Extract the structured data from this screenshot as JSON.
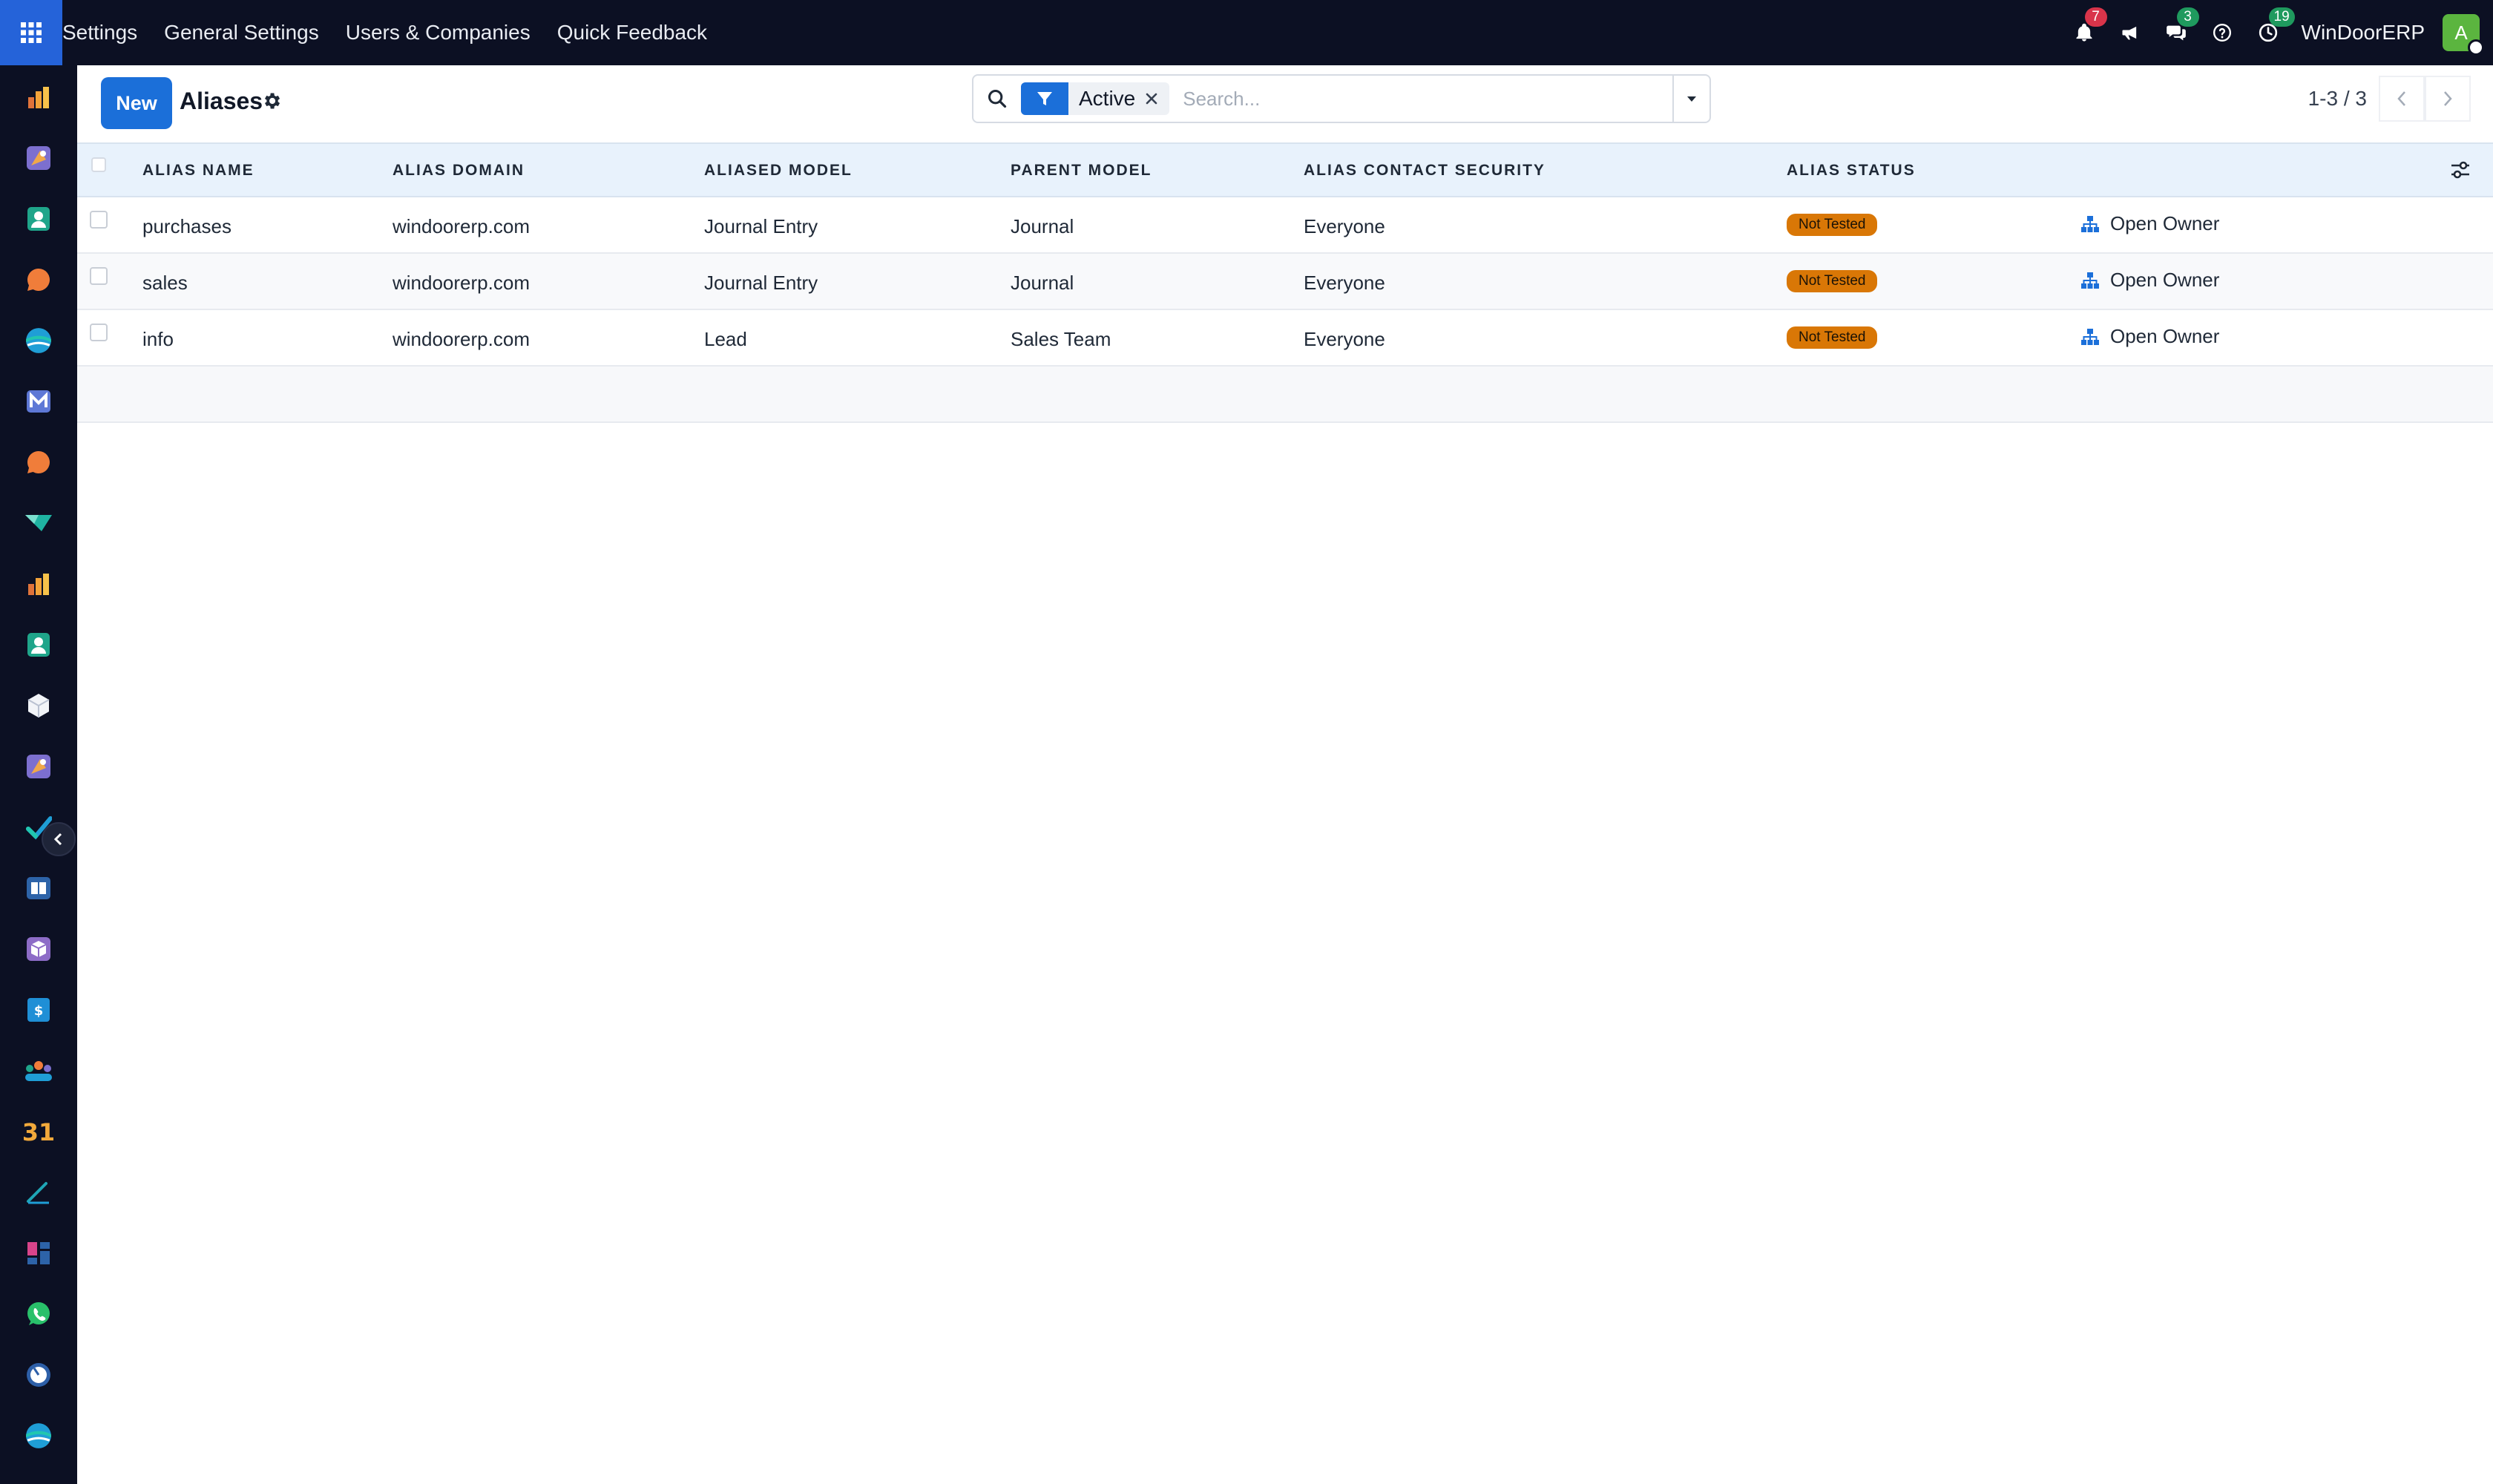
{
  "topbar": {
    "apps_icon": "grid-icon",
    "menu": [
      "Settings",
      "General Settings",
      "Users & Companies",
      "Quick Feedback"
    ],
    "notifications_count": "7",
    "messages_count": "3",
    "activities_count": "19",
    "company": "WinDoorERP",
    "avatar_initial": "A",
    "avatar_color": "#5bb53f"
  },
  "rail": {
    "apps": [
      "sales-app",
      "products-app",
      "contacts-app",
      "discuss-app",
      "website-app",
      "email-marketing-app",
      "livechat-app",
      "project-app",
      "reporting-app",
      "employees-app",
      "inventory-app",
      "crm-app",
      "todo-app",
      "knowledge-app",
      "manufacturing-app",
      "invoicing-app",
      "team-app",
      "calendar-app",
      "sign-app",
      "dashboards-app",
      "whatsapp-app",
      "timesheets-app",
      "website-2-app"
    ],
    "calendar_day": "31"
  },
  "control": {
    "new_label": "New",
    "title": "Aliases",
    "facet_label": "Active",
    "search_placeholder": "Search...",
    "pager_value": "1-3 / 3"
  },
  "table": {
    "columns": [
      "ALIAS NAME",
      "ALIAS DOMAIN",
      "ALIASED MODEL",
      "PARENT MODEL",
      "ALIAS CONTACT SECURITY",
      "ALIAS STATUS"
    ],
    "rows": [
      {
        "name": "purchases",
        "domain": "windoorerp.com",
        "model": "Journal Entry",
        "parent": "Journal",
        "security": "Everyone",
        "status": "Not Tested",
        "action": "Open Owner"
      },
      {
        "name": "sales",
        "domain": "windoorerp.com",
        "model": "Journal Entry",
        "parent": "Journal",
        "security": "Everyone",
        "status": "Not Tested",
        "action": "Open Owner"
      },
      {
        "name": "info",
        "domain": "windoorerp.com",
        "model": "Lead",
        "parent": "Sales Team",
        "security": "Everyone",
        "status": "Not Tested",
        "action": "Open Owner"
      }
    ]
  },
  "colors": {
    "topbar_bg": "#0c1023",
    "primary": "#1b6fd9",
    "status_warning": "#d97706",
    "header_bg": "#e8f2fc"
  }
}
